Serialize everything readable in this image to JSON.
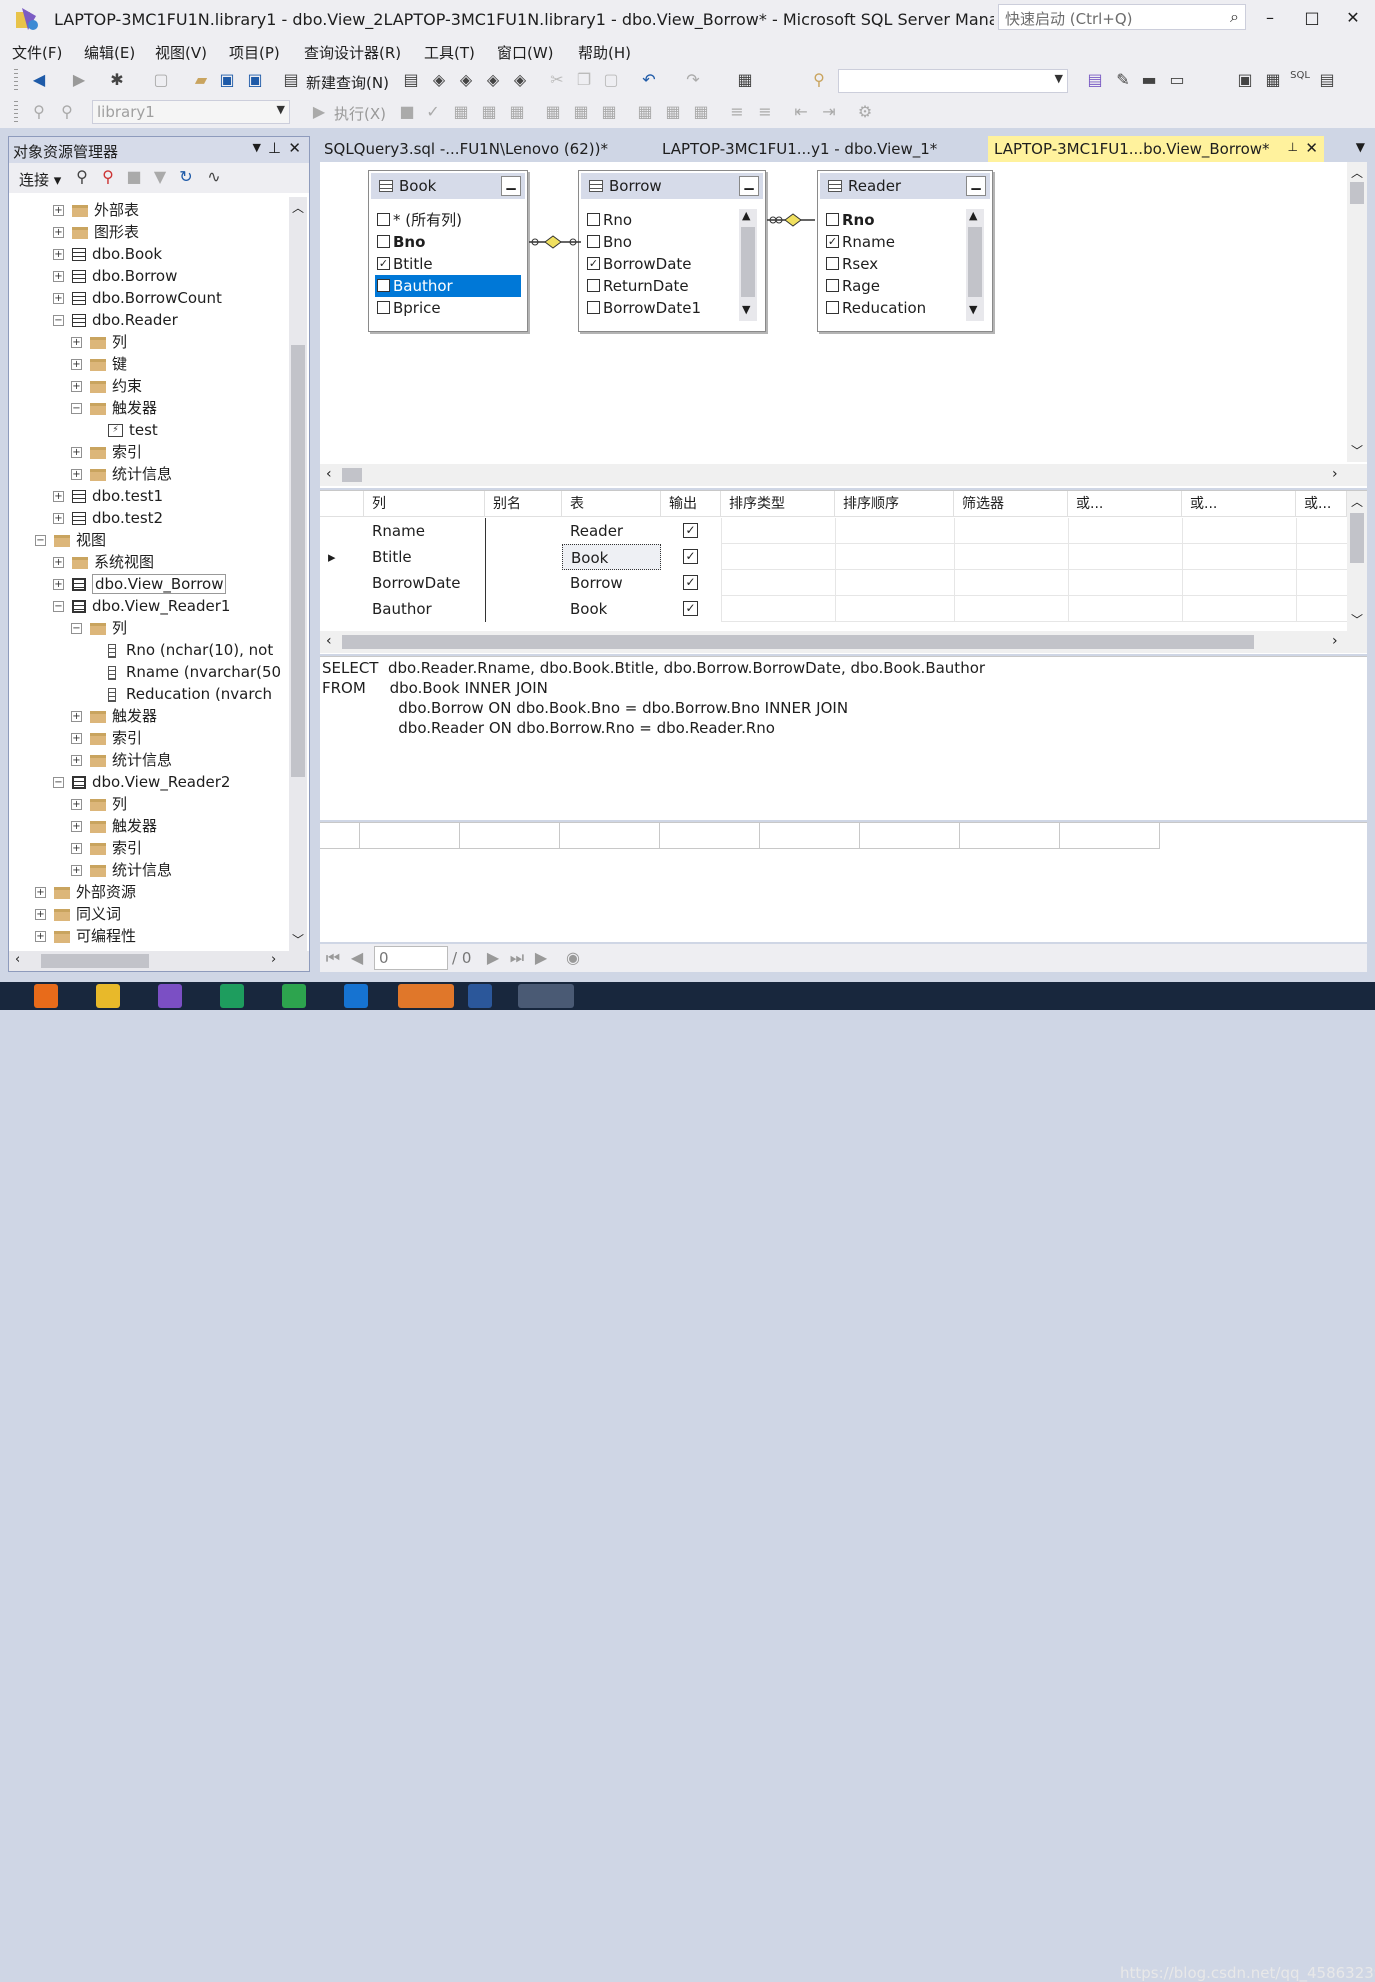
{
  "title_bar": {
    "title": "LAPTOP-3MC1FU1N.library1 - dbo.View_2LAPTOP-3MC1FU1N.library1 - dbo.View_Borrow* - Microsoft SQL Server Managemen...",
    "quick_launch_placeholder": "快速启动 (Ctrl+Q)",
    "minimize": "–",
    "maximize": "□",
    "close": "✕"
  },
  "menu": [
    "文件(F)",
    "编辑(E)",
    "视图(V)",
    "项目(P)",
    "查询设计器(R)",
    "工具(T)",
    "窗口(W)",
    "帮助(H)"
  ],
  "toolbar": {
    "new_query": "新建查询(N)",
    "database": "library1",
    "execute": "执行(X)"
  },
  "object_explorer": {
    "title": "对象资源管理器",
    "connect": "连接",
    "tree": [
      {
        "label": "外部表",
        "type": "folder",
        "expander": "+"
      },
      {
        "label": "图形表",
        "type": "folder",
        "expander": "+"
      },
      {
        "label": "dbo.Book",
        "type": "table",
        "expander": "+"
      },
      {
        "label": "dbo.Borrow",
        "type": "table",
        "expander": "+"
      },
      {
        "label": "dbo.BorrowCount",
        "type": "table",
        "expander": "+"
      },
      {
        "label": "dbo.Reader",
        "type": "table",
        "expander": "−"
      },
      {
        "label": "列",
        "type": "folder",
        "expander": "+"
      },
      {
        "label": "键",
        "type": "folder",
        "expander": "+"
      },
      {
        "label": "约束",
        "type": "folder",
        "expander": "+"
      },
      {
        "label": "触发器",
        "type": "folder",
        "expander": "−"
      },
      {
        "label": "test",
        "type": "trigger",
        "expander": ""
      },
      {
        "label": "索引",
        "type": "folder",
        "expander": "+"
      },
      {
        "label": "统计信息",
        "type": "folder",
        "expander": "+"
      },
      {
        "label": "dbo.test1",
        "type": "table",
        "expander": "+"
      },
      {
        "label": "dbo.test2",
        "type": "table",
        "expander": "+"
      },
      {
        "label": "视图",
        "type": "folder",
        "expander": "−"
      },
      {
        "label": "系统视图",
        "type": "folder",
        "expander": "+"
      },
      {
        "label": "dbo.View_Borrow",
        "type": "view",
        "expander": "+",
        "selected": true
      },
      {
        "label": "dbo.View_Reader1",
        "type": "view",
        "expander": "−"
      },
      {
        "label": "列",
        "type": "folder",
        "expander": "−"
      },
      {
        "label": "Rno (nchar(10), not",
        "type": "column",
        "expander": ""
      },
      {
        "label": "Rname (nvarchar(50",
        "type": "column",
        "expander": ""
      },
      {
        "label": "Reducation (nvarch",
        "type": "column",
        "expander": ""
      },
      {
        "label": "触发器",
        "type": "folder",
        "expander": "+"
      },
      {
        "label": "索引",
        "type": "folder",
        "expander": "+"
      },
      {
        "label": "统计信息",
        "type": "folder",
        "expander": "+"
      },
      {
        "label": "dbo.View_Reader2",
        "type": "view",
        "expander": "−"
      },
      {
        "label": "列",
        "type": "folder",
        "expander": "+"
      },
      {
        "label": "触发器",
        "type": "folder",
        "expander": "+"
      },
      {
        "label": "索引",
        "type": "folder",
        "expander": "+"
      },
      {
        "label": "统计信息",
        "type": "folder",
        "expander": "+"
      },
      {
        "label": "外部资源",
        "type": "folder",
        "expander": "+"
      },
      {
        "label": "同义词",
        "type": "folder",
        "expander": "+"
      },
      {
        "label": "可编程性",
        "type": "folder",
        "expander": "+"
      }
    ]
  },
  "doc_tabs": [
    {
      "label": "SQLQuery3.sql -...FU1N\\Lenovo (62))*"
    },
    {
      "label": "LAPTOP-3MC1FU1...y1 - dbo.View_1*"
    },
    {
      "label": "LAPTOP-3MC1FU1...bo.View_Borrow*",
      "active": true
    }
  ],
  "diagram": {
    "tables": [
      {
        "name": "Book",
        "columns": [
          {
            "label": "* (所有列)",
            "checked": false
          },
          {
            "label": "Bno",
            "checked": false,
            "bold": true
          },
          {
            "label": "Btitle",
            "checked": true
          },
          {
            "label": "Bauthor",
            "checked": true,
            "highlighted": true
          },
          {
            "label": "Bprice",
            "checked": false
          }
        ]
      },
      {
        "name": "Borrow",
        "columns": [
          {
            "label": "Rno",
            "checked": false
          },
          {
            "label": "Bno",
            "checked": false
          },
          {
            "label": "BorrowDate",
            "checked": true
          },
          {
            "label": "ReturnDate",
            "checked": false
          },
          {
            "label": "BorrowDate1",
            "checked": false
          }
        ]
      },
      {
        "name": "Reader",
        "columns": [
          {
            "label": "Rno",
            "checked": false,
            "bold": true
          },
          {
            "label": "Rname",
            "checked": true
          },
          {
            "label": "Rsex",
            "checked": false
          },
          {
            "label": "Rage",
            "checked": false
          },
          {
            "label": "Reducation",
            "checked": false
          }
        ]
      }
    ]
  },
  "criteria_grid": {
    "headers": [
      "列",
      "别名",
      "表",
      "输出",
      "排序类型",
      "排序顺序",
      "筛选器",
      "或...",
      "或...",
      "或..."
    ],
    "rows": [
      {
        "column": "Rname",
        "alias": "",
        "table": "Reader",
        "output": true
      },
      {
        "column": "Btitle",
        "alias": "",
        "table": "Book",
        "output": true,
        "current": true
      },
      {
        "column": "BorrowDate",
        "alias": "",
        "table": "Borrow",
        "output": true
      },
      {
        "column": "Bauthor",
        "alias": "",
        "table": "Book",
        "output": true
      }
    ]
  },
  "sql_pane": {
    "lines": [
      "SELECT  dbo.Reader.Rname, dbo.Book.Btitle, dbo.Borrow.BorrowDate, dbo.Book.Bauthor",
      "FROM     dbo.Book INNER JOIN",
      "                dbo.Borrow ON dbo.Book.Bno = dbo.Borrow.Bno INNER JOIN",
      "                dbo.Reader ON dbo.Borrow.Rno = dbo.Reader.Rno"
    ]
  },
  "nav": {
    "record": "0",
    "total": "/ 0"
  },
  "watermark": "https://blog.csdn.net/qq_45863239",
  "colors": {
    "active_tab": "#fff29d",
    "selection": "#0078d7",
    "taskbar": "#18273d"
  }
}
